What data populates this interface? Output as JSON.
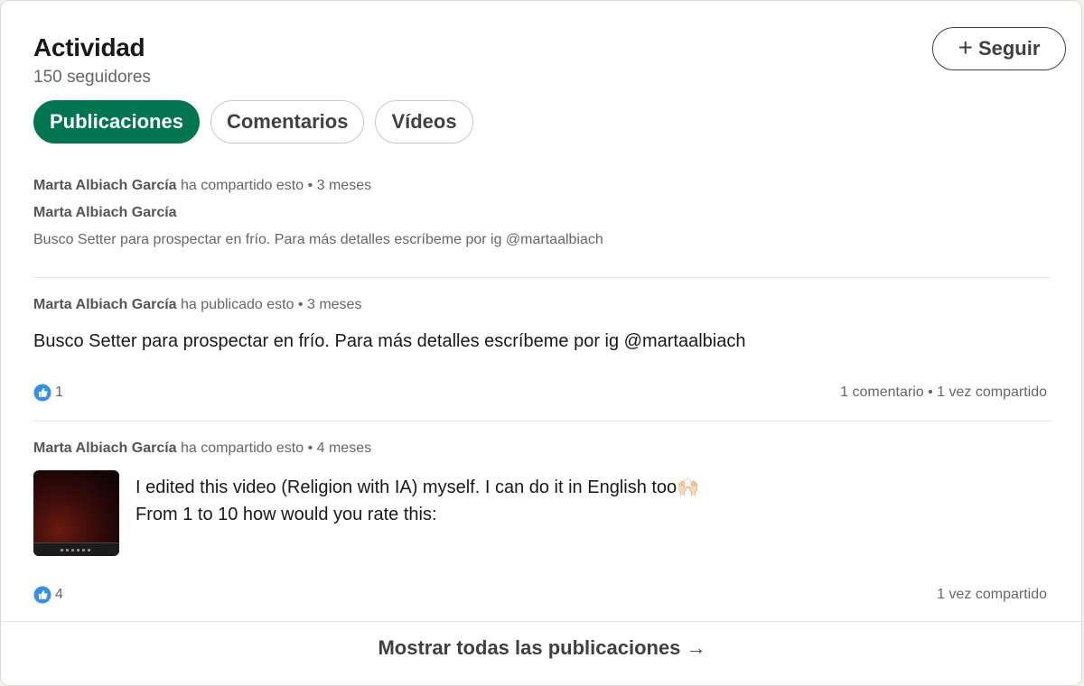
{
  "header": {
    "title": "Actividad",
    "followers": "150 seguidores",
    "follow_label": "Seguir",
    "follow_icon": "plus-icon"
  },
  "tabs": [
    {
      "label": "Publicaciones",
      "active": true
    },
    {
      "label": "Comentarios",
      "active": false
    },
    {
      "label": "Vídeos",
      "active": false
    }
  ],
  "posts": [
    {
      "author": "Marta Albiach García",
      "action": "ha compartido esto",
      "time": "3 meses",
      "shared_author": "Marta Albiach García",
      "text": "Busco Setter para prospectar en frío. Para más detalles escríbeme por ig @martaalbiach"
    },
    {
      "author": "Marta Albiach García",
      "action": "ha publicado esto",
      "time": "3 meses",
      "text": "Busco Setter para prospectar en frío. Para más detalles escríbeme por ig @martaalbiach",
      "reactions": "1",
      "stats": "1 comentario • 1 vez compartido"
    },
    {
      "author": "Marta Albiach García",
      "action": "ha compartido esto",
      "time": "4 meses",
      "text_line1": "I edited this video (Religion with IA) myself. I can do it in English too🙌🏻",
      "text_line2": "From 1 to 10 how would you rate this:",
      "reactions": "4",
      "stats": "1 vez compartido"
    }
  ],
  "footer": {
    "show_all": "Mostrar todas las publicaciones →"
  },
  "colors": {
    "accent_green": "#01754f",
    "like_blue": "#378fe9"
  }
}
